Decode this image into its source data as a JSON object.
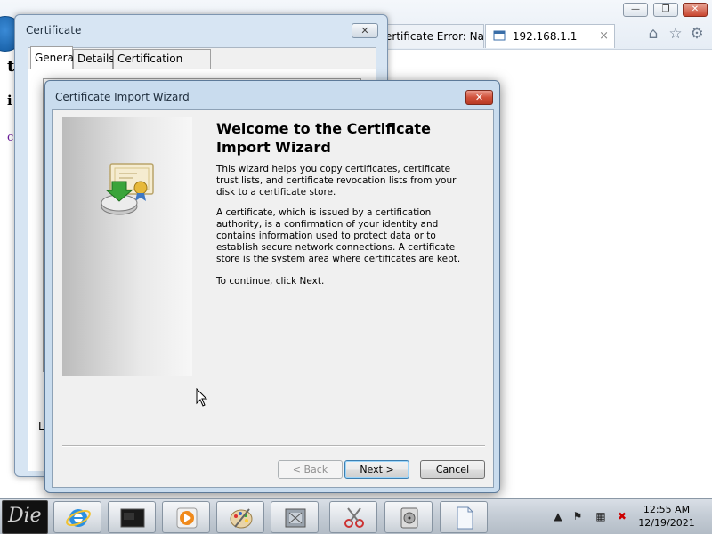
{
  "browser": {
    "tabs": [
      {
        "label": "ertificate Error: Na...",
        "active": false
      },
      {
        "label": "192.168.1.1",
        "active": true
      }
    ],
    "tab_close": "×",
    "page_fragments": {
      "heading": "t",
      "line": "i",
      "link": "c"
    },
    "controls": {
      "minimize": "—",
      "maximize": "❐",
      "close": "✕"
    }
  },
  "cert_dialog": {
    "title": "Certificate",
    "close": "✕",
    "tabs": [
      "General",
      "Details",
      "Certification Path"
    ],
    "footer_fragment": "Le"
  },
  "wizard": {
    "title": "Certificate Import Wizard",
    "close": "✕",
    "heading": "Welcome to the Certificate Import Wizard",
    "paragraphs": [
      "This wizard helps you copy certificates, certificate trust lists, and certificate revocation lists from your disk to a certificate store.",
      "A certificate, which is issued by a certification authority, is a confirmation of your identity and contains information used to protect data or to establish secure network connections. A certificate store is the system area where certificates are kept.",
      "To continue, click Next."
    ],
    "buttons": {
      "back": "< Back",
      "next": "Next >",
      "cancel": "Cancel"
    }
  },
  "taskbar": {
    "start_label": "Die",
    "time": "12:55 AM",
    "date": "12/19/2021",
    "apps": [
      "internet-explorer",
      "terminal",
      "media-player",
      "paint",
      "archive",
      "snipping-tool",
      "disk-utility",
      "document"
    ]
  }
}
